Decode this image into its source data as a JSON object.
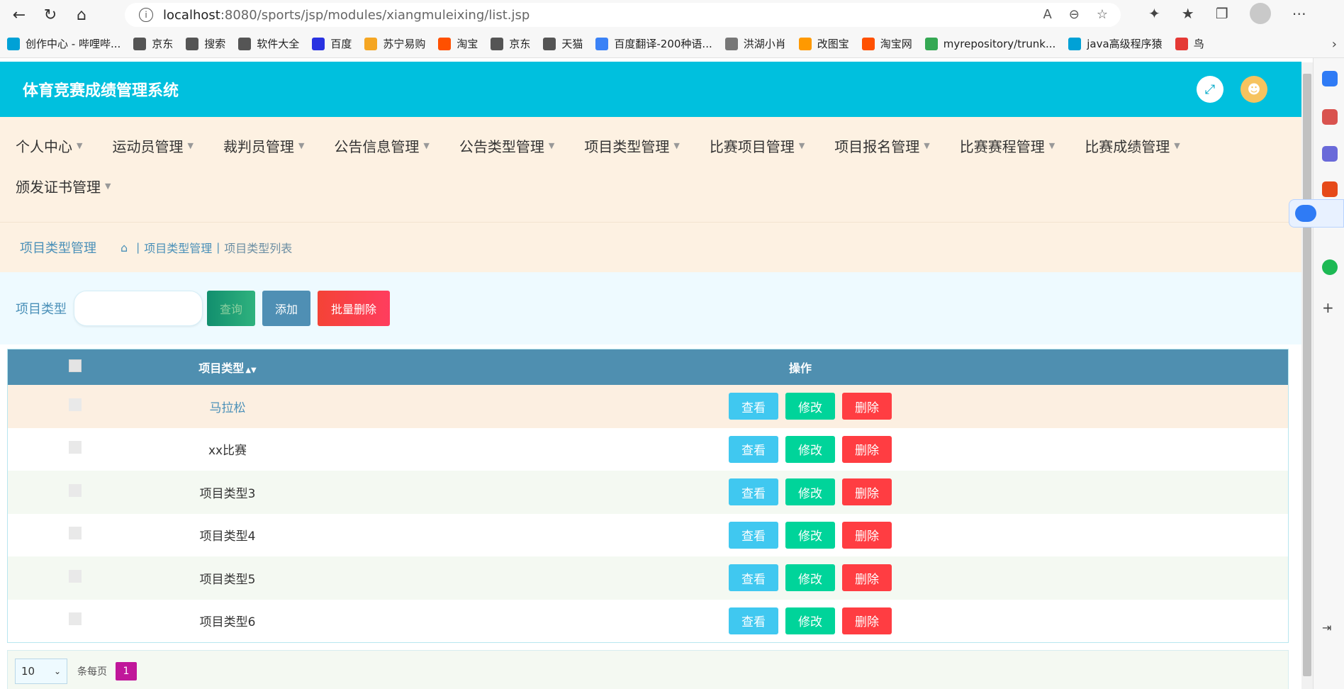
{
  "browser": {
    "url_host": "localhost",
    "url_path": ":8080/sports/jsp/modules/xiangmuleixing/list.jsp"
  },
  "bookmarks": [
    {
      "label": "创作中心 - 哔哩哔...",
      "color": "#00a1d6"
    },
    {
      "label": "京东",
      "color": "#555555"
    },
    {
      "label": "搜索",
      "color": "#555555"
    },
    {
      "label": "软件大全",
      "color": "#555555"
    },
    {
      "label": "百度",
      "color": "#2932e1"
    },
    {
      "label": "苏宁易购",
      "color": "#f5a623"
    },
    {
      "label": "淘宝",
      "color": "#ff5000"
    },
    {
      "label": "京东",
      "color": "#555555"
    },
    {
      "label": "天猫",
      "color": "#555555"
    },
    {
      "label": "百度翻译-200种语...",
      "color": "#3b82f6"
    },
    {
      "label": "洪湖小肖",
      "color": "#777777"
    },
    {
      "label": "改图宝",
      "color": "#ff9900"
    },
    {
      "label": "淘宝网",
      "color": "#ff5000"
    },
    {
      "label": "myrepository/trunk...",
      "color": "#34a853"
    },
    {
      "label": "java高级程序猿",
      "color": "#00a1d6"
    },
    {
      "label": "鸟",
      "color": "#e53935"
    }
  ],
  "app": {
    "title": "体育竞赛成绩管理系统"
  },
  "menu": {
    "row1": [
      "个人中心",
      "运动员管理",
      "裁判员管理",
      "公告信息管理",
      "公告类型管理",
      "项目类型管理",
      "比赛项目管理",
      "项目报名管理",
      "比赛赛程管理",
      "比赛成绩管理"
    ],
    "row2": [
      "颁发证书管理"
    ]
  },
  "breadcrumb": {
    "title": "项目类型管理",
    "link": "项目类型管理",
    "current": "项目类型列表"
  },
  "search": {
    "label": "项目类型",
    "query_label": "查询",
    "add_label": "添加",
    "bulk_delete_label": "批量删除"
  },
  "table": {
    "col_type": "项目类型",
    "col_ops": "操作",
    "view_label": "查看",
    "edit_label": "修改",
    "delete_label": "删除",
    "rows": [
      "马拉松",
      "xx比赛",
      "项目类型3",
      "项目类型4",
      "项目类型5",
      "项目类型6"
    ]
  },
  "pager": {
    "page_size": "10",
    "per_page_label": "条每页",
    "current_page": "1"
  },
  "colors": {
    "header": "#00c0de",
    "menu_bg": "#fdf1e2",
    "table_head": "#4f8fb0",
    "view": "#40c8f0",
    "edit": "#00d49a",
    "delete": "#ff3d42"
  }
}
